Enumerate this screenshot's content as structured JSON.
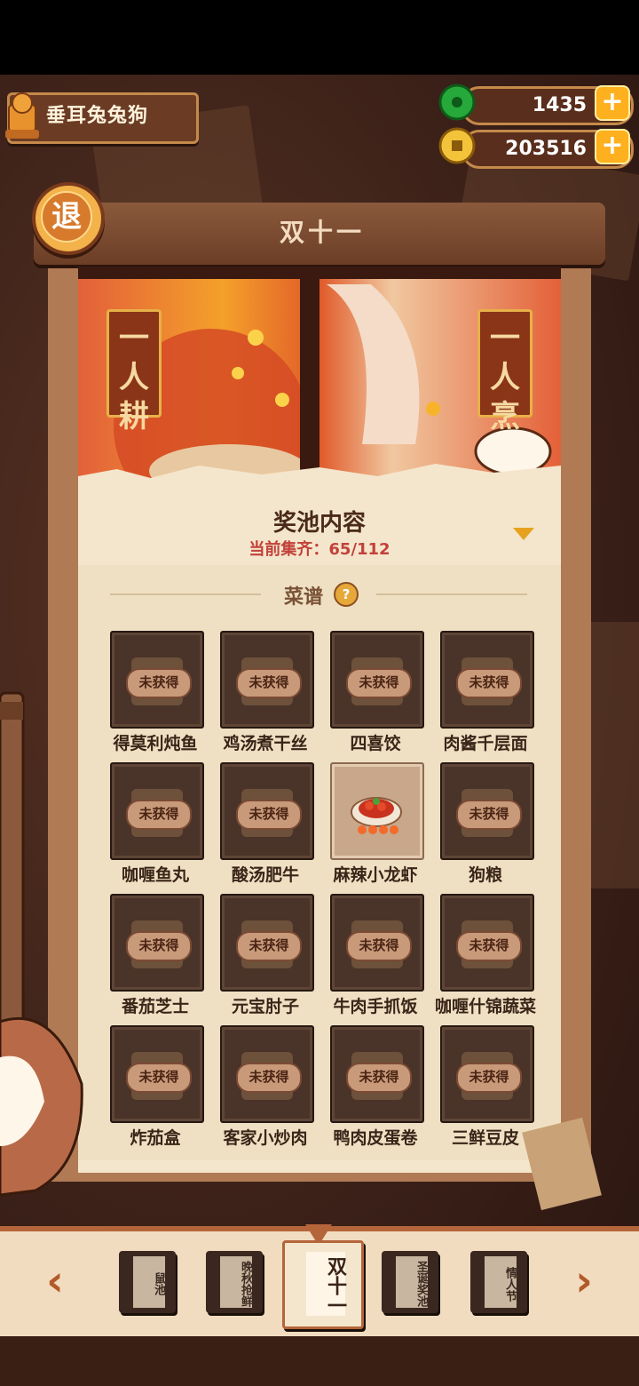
{
  "player": {
    "name": "垂耳兔兔狗"
  },
  "resources": {
    "jade": "1435",
    "coins": "203516",
    "plus_label": "+"
  },
  "back_button": {
    "label": "退"
  },
  "event_title": "双十一",
  "banner": {
    "left_plaque": "一人耕",
    "right_plaque": "一人烹"
  },
  "pool": {
    "title": "奖池内容",
    "progress": "当前集齐：65/112"
  },
  "section": {
    "title": "菜谱",
    "help_glyph": "?"
  },
  "recipes": [
    {
      "name": "得莫利炖鱼",
      "status": "未获得"
    },
    {
      "name": "鸡汤煮干丝",
      "status": "未获得"
    },
    {
      "name": "四喜饺",
      "status": "未获得"
    },
    {
      "name": "肉酱千层面",
      "status": "未获得"
    },
    {
      "name": "咖喱鱼丸",
      "status": "未获得"
    },
    {
      "name": "酸汤肥牛",
      "status": "未获得"
    },
    {
      "name": "麻辣小龙虾",
      "status": ""
    },
    {
      "name": "狗粮",
      "status": "未获得"
    },
    {
      "name": "番茄芝士",
      "status": "未获得"
    },
    {
      "name": "元宝肘子",
      "status": "未获得"
    },
    {
      "name": "牛肉手抓饭",
      "status": "未获得"
    },
    {
      "name": "咖喱什锦蔬菜",
      "status": "未获得"
    },
    {
      "name": "炸茄盒",
      "status": "未获得"
    },
    {
      "name": "客家小炒肉",
      "status": "未获得"
    },
    {
      "name": "鸭肉皮蛋卷",
      "status": "未获得"
    },
    {
      "name": "三鲜豆皮",
      "status": "未获得"
    }
  ],
  "tabs": [
    {
      "label": "鼠池"
    },
    {
      "label": "晚秋抢鲜"
    },
    {
      "label": "双十一"
    },
    {
      "label": "圣诞奖池"
    },
    {
      "label": "情人节"
    }
  ],
  "nav": {
    "prev": "‹",
    "next": "›"
  }
}
